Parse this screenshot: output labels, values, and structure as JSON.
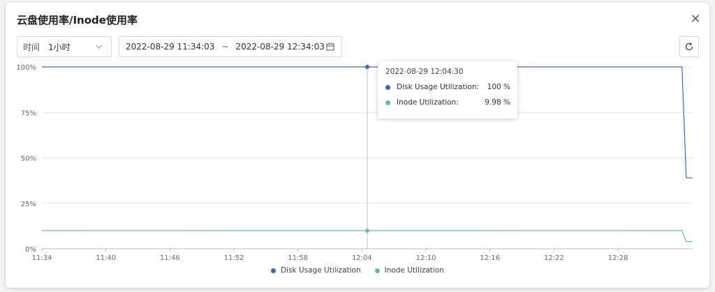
{
  "header": {
    "title": "云盘使用率/Inode使用率"
  },
  "filters": {
    "time_label": "时间",
    "time_value": "1小时",
    "range_start": "2022-08-29 11:34:03",
    "range_separator": "~",
    "range_end": "2022-08-29 12:34:03"
  },
  "tooltip": {
    "time": "2022-08-29 12:04:30",
    "rows": [
      {
        "name": "Disk Usage Utilization:",
        "value": "100 %"
      },
      {
        "name": "Inode Utilization:",
        "value": "9.98 %"
      }
    ]
  },
  "colors": {
    "disk": "#3a66c4",
    "inode": "#5cc39a",
    "grid": "#e3e3e3"
  },
  "chart_data": {
    "type": "line",
    "x_tick_labels": [
      "11:34",
      "11:40",
      "11:46",
      "11:52",
      "11:58",
      "12:04",
      "12:10",
      "12:16",
      "12:22",
      "12:28"
    ],
    "y_tick_labels": [
      "100%",
      "75%",
      "50%",
      "25%",
      "0%"
    ],
    "xlim_minutes": [
      0,
      61
    ],
    "ylim": [
      0,
      100
    ],
    "grid": true,
    "legend_position": "bottom",
    "series": [
      {
        "name": "Disk Usage Utilization",
        "color": "#3a66c4",
        "points": [
          [
            0,
            100
          ],
          [
            30.5,
            100
          ],
          [
            60,
            100
          ],
          [
            60.4,
            39
          ],
          [
            61,
            39
          ]
        ]
      },
      {
        "name": "Inode Utilization",
        "color": "#5cc39a",
        "points": [
          [
            0,
            10
          ],
          [
            30.5,
            9.98
          ],
          [
            60,
            10
          ],
          [
            60.4,
            4
          ],
          [
            61,
            4
          ]
        ]
      }
    ],
    "hover_x": 30.5
  }
}
